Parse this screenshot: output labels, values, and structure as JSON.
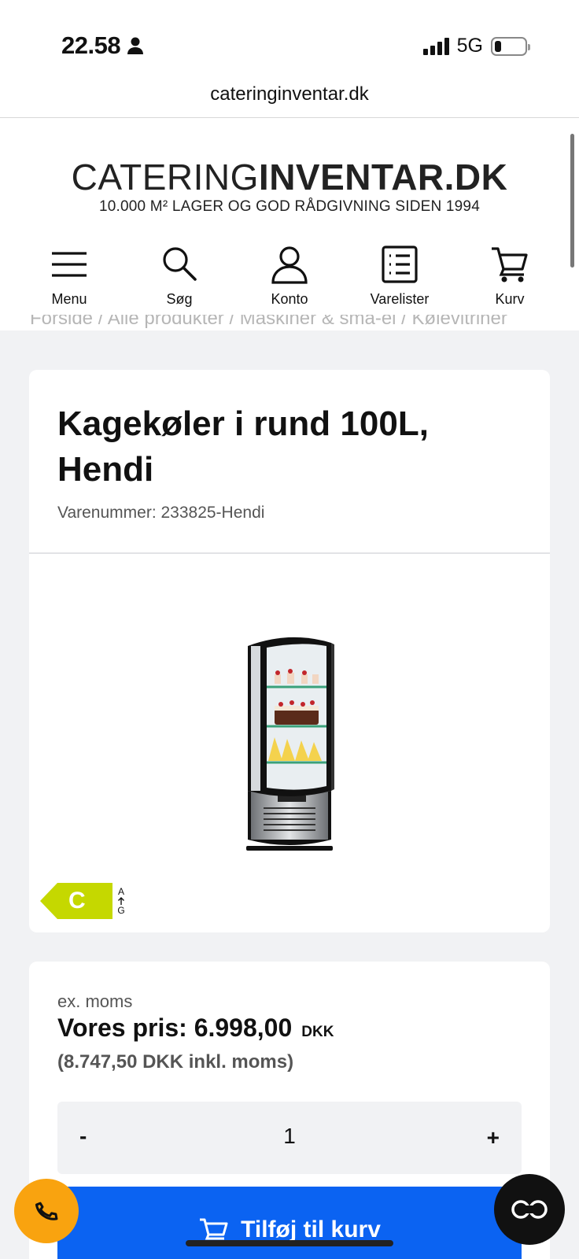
{
  "status_bar": {
    "time": "22.58",
    "network": "5G"
  },
  "browser": {
    "url": "cateringinventar.dk"
  },
  "site": {
    "logo_light": "CATERING",
    "logo_bold": "INVENTAR.DK",
    "tagline": "10.000 M² LAGER OG GOD RÅDGIVNING SIDEN 1994"
  },
  "nav": [
    {
      "label": "Menu",
      "icon": "menu-icon"
    },
    {
      "label": "Søg",
      "icon": "search-icon"
    },
    {
      "label": "Konto",
      "icon": "user-icon"
    },
    {
      "label": "Varelister",
      "icon": "list-icon"
    },
    {
      "label": "Kurv",
      "icon": "cart-icon"
    }
  ],
  "breadcrumb": "Forside / Alle produkter / Maskiner & smá-el / Kølevitriner",
  "product": {
    "title": "Kagekøler i rund 100L, Hendi",
    "sku": "Varenummer: 233825-Hendi",
    "energy_class": "C",
    "energy_top": "A",
    "energy_bottom": "G"
  },
  "pricing": {
    "ex_moms": "ex. moms",
    "price_label": "Vores pris: 6.998,00",
    "currency": "DKK",
    "price_incl": "(8.747,50  DKK inkl. moms)"
  },
  "quantity": {
    "minus": "-",
    "value": "1",
    "plus": "+"
  },
  "cart_button": {
    "label": "Tilføj til kurv"
  },
  "colors": {
    "accent": "#0b63f2",
    "phone": "#f9a30f",
    "energy": "#c5d800"
  }
}
